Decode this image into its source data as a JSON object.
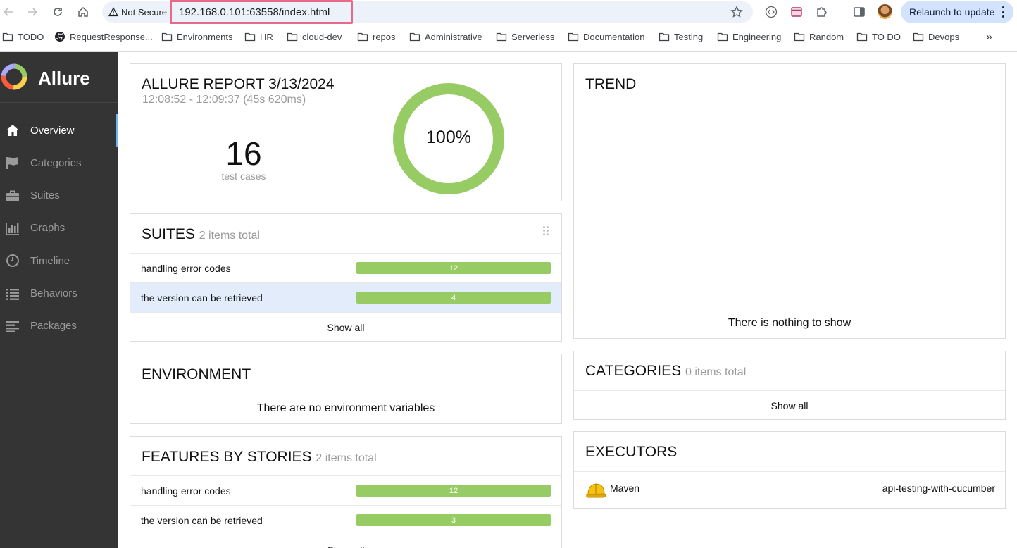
{
  "browser": {
    "security_label": "Not Secure",
    "url": "192.168.0.101:63558/index.html",
    "relaunch_label": "Relaunch to update",
    "bookmarks": [
      {
        "label": "TODO",
        "icon": "folder-icon"
      },
      {
        "label": "RequestResponse...",
        "icon": "github-icon"
      },
      {
        "label": "Environments",
        "icon": "folder-icon"
      },
      {
        "label": "HR",
        "icon": "folder-icon"
      },
      {
        "label": "cloud-dev",
        "icon": "folder-icon"
      },
      {
        "label": "repos",
        "icon": "folder-icon"
      },
      {
        "label": "Administrative",
        "icon": "folder-icon"
      },
      {
        "label": "Serverless",
        "icon": "folder-icon"
      },
      {
        "label": "Documentation",
        "icon": "folder-icon"
      },
      {
        "label": "Testing",
        "icon": "folder-icon"
      },
      {
        "label": "Engineering",
        "icon": "folder-icon"
      },
      {
        "label": "Random",
        "icon": "folder-icon"
      },
      {
        "label": "TO DO",
        "icon": "folder-icon"
      },
      {
        "label": "Devops",
        "icon": "folder-icon"
      }
    ],
    "more_label": "»"
  },
  "sidebar": {
    "brand": "Allure",
    "items": [
      {
        "label": "Overview",
        "icon": "home-icon",
        "active": true
      },
      {
        "label": "Categories",
        "icon": "flag-icon"
      },
      {
        "label": "Suites",
        "icon": "briefcase-icon"
      },
      {
        "label": "Graphs",
        "icon": "bar-chart-icon"
      },
      {
        "label": "Timeline",
        "icon": "clock-icon"
      },
      {
        "label": "Behaviors",
        "icon": "list-icon"
      },
      {
        "label": "Packages",
        "icon": "align-left-icon"
      }
    ]
  },
  "summary": {
    "title": "ALLURE REPORT 3/13/2024",
    "time_range": "12:08:52 - 12:09:37 (45s 620ms)",
    "test_count": "16",
    "test_count_label": "test cases",
    "pass_rate_label": "100%",
    "pass_rate": 1.0,
    "ring_color": "#97cc64"
  },
  "suites": {
    "title": "SUITES",
    "subtitle": "2 items total",
    "rows": [
      {
        "name": "handling error codes",
        "count": "12",
        "share": 1.0
      },
      {
        "name": "the version can be retrieved",
        "count": "4",
        "share": 1.0
      }
    ],
    "show_all": "Show all"
  },
  "environment": {
    "title": "ENVIRONMENT",
    "empty": "There are no environment variables"
  },
  "features": {
    "title": "FEATURES BY STORIES",
    "subtitle": "2 items total",
    "rows": [
      {
        "name": "handling error codes",
        "count": "12",
        "share": 1.0
      },
      {
        "name": "the version can be retrieved",
        "count": "3",
        "share": 1.0
      }
    ],
    "show_all": "Show all"
  },
  "trend": {
    "title": "TREND",
    "empty": "There is nothing to show"
  },
  "categories": {
    "title": "CATEGORIES",
    "subtitle": "0 items total",
    "show_all": "Show all"
  },
  "executors": {
    "title": "EXECUTORS",
    "name": "Maven",
    "build": "api-testing-with-cucumber",
    "icon": "hard-hat-icon"
  },
  "colors": {
    "passed": "#97cc64",
    "sidebar_bg": "#343434",
    "active_marker": "#6eb5f5"
  }
}
